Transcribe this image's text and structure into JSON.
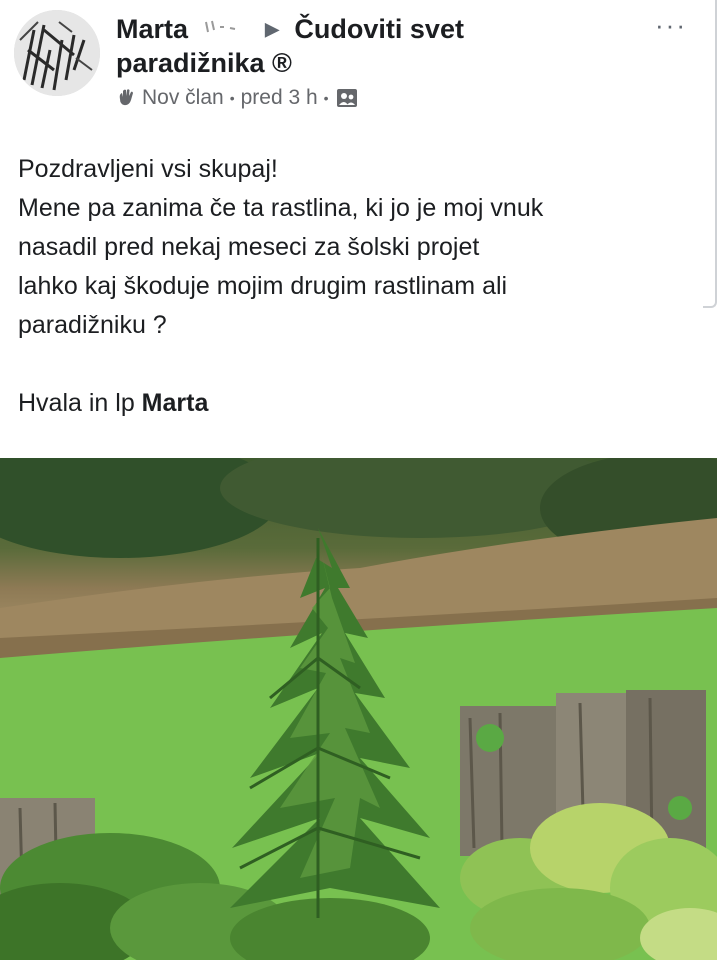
{
  "post": {
    "author_name": "Marta",
    "group_name_line1": "Čudoviti svet",
    "group_name_line2": "paradižnika ®",
    "badge": "Nov član",
    "time": "pred 3 h",
    "more_label": "···",
    "body_lines": [
      "Pozdravljeni vsi skupaj!",
      "Mene pa zanima če ta rastlina, ki jo je moj vnuk",
      "nasadil pred nekaj meseci za šolski projet",
      "lahko kaj škoduje mojim drugim rastlinam ali",
      "paradižniku ?"
    ],
    "signoff_text": "Hvala in lp ",
    "signoff_name": "Marta"
  },
  "icons": {
    "badge_icon": "wave-hand-icon",
    "audience_icon": "group-members-icon",
    "arrow_icon": "triangle-right-icon",
    "more_icon": "more-options-icon"
  },
  "colors": {
    "text": "#1c1e21",
    "secondary_text": "#65676b",
    "photo_grass": "#7cc35a",
    "photo_plant": "#3f7a2d"
  }
}
